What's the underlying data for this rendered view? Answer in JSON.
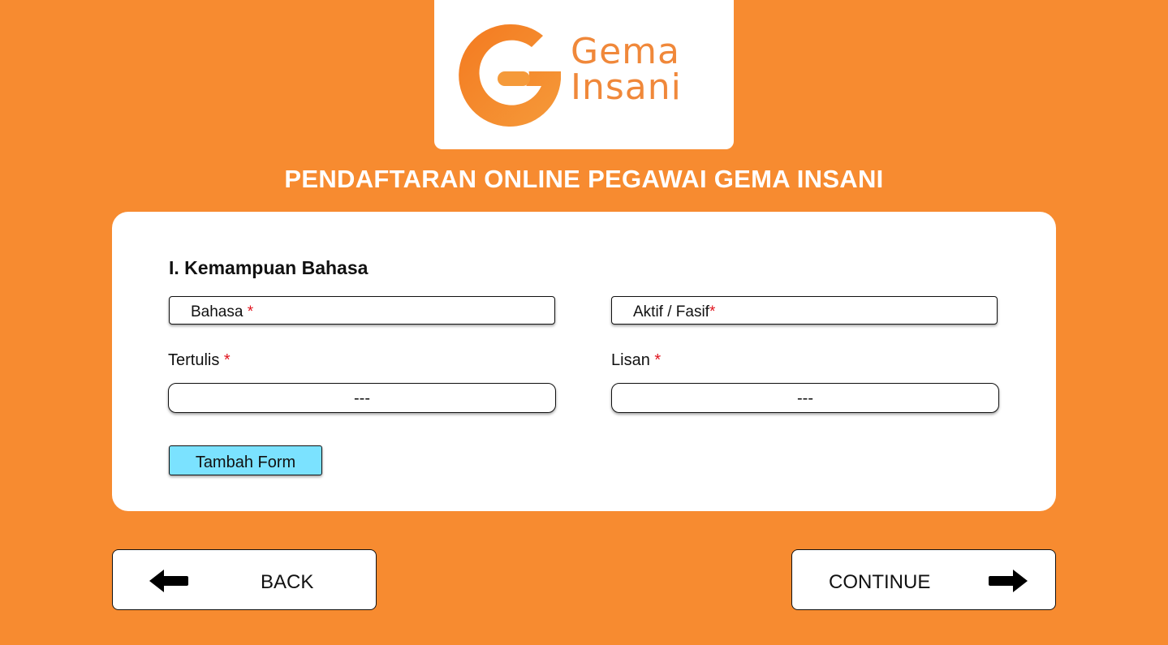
{
  "logo": {
    "line1": "Gema",
    "line2": "Insani",
    "icon": "gema-insani-logo-icon",
    "color": "#F0883A"
  },
  "page": {
    "title": "PENDAFTARAN ONLINE PEGAWAI GEMA INSANI",
    "background": "#F78B30"
  },
  "form": {
    "section_title": "I. Kemampuan Bahasa",
    "required_mark": "*",
    "bahasa_placeholder": "Bahasa",
    "aktif_fasif_placeholder": "Aktif / Fasif",
    "tertulis_label": "Tertulis",
    "tertulis_value": "---",
    "lisan_label": "Lisan",
    "lisan_value": "---",
    "add_button": "Tambah Form",
    "add_button_color": "#7BE2FF"
  },
  "nav": {
    "back_label": "BACK",
    "back_icon": "arrow-left-icon",
    "continue_label": "CONTINUE",
    "continue_icon": "arrow-right-icon"
  }
}
